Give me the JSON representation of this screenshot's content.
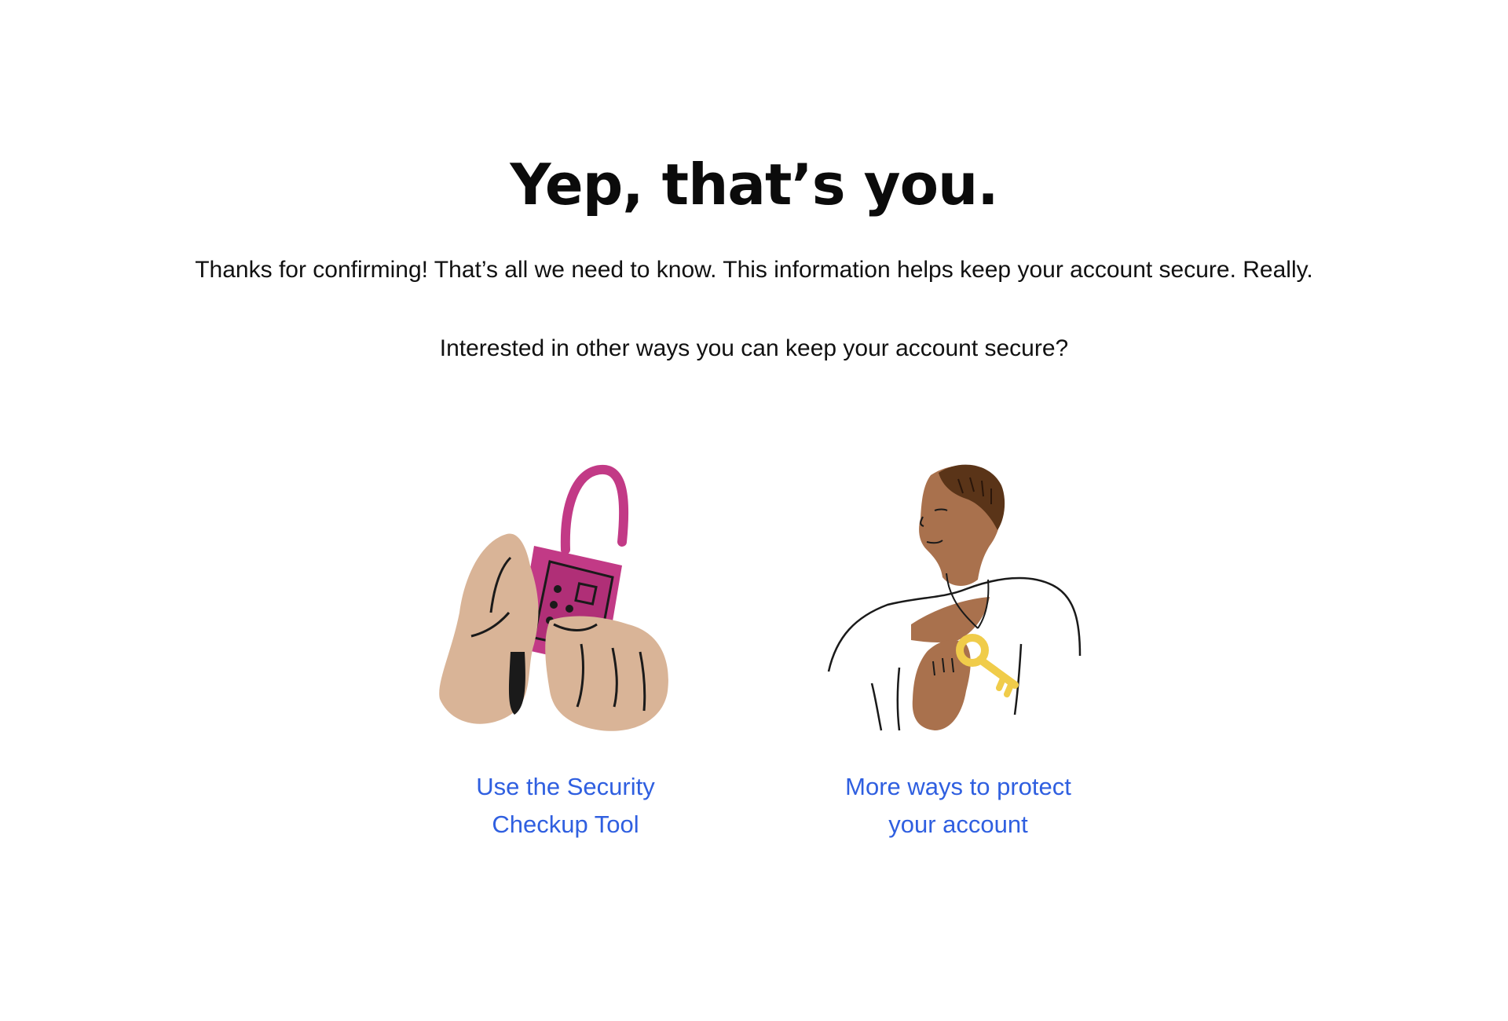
{
  "page": {
    "title": "Yep, that’s you.",
    "lead": "Thanks for confirming! That’s all we need to know. This information helps keep your account secure. Really.",
    "question": "Interested in other ways you can keep your account secure?"
  },
  "cards": [
    {
      "illustration": "hands-holding-padlock-illustration",
      "link_label": "Use the Security Checkup Tool"
    },
    {
      "illustration": "person-holding-key-illustration",
      "link_label": "More ways to protect your account"
    }
  ],
  "colors": {
    "link": "#2f5fe0",
    "padlock": "#c23a86",
    "skin_light": "#d9b497",
    "skin_dark": "#a9714d",
    "key": "#f0cc4a"
  }
}
